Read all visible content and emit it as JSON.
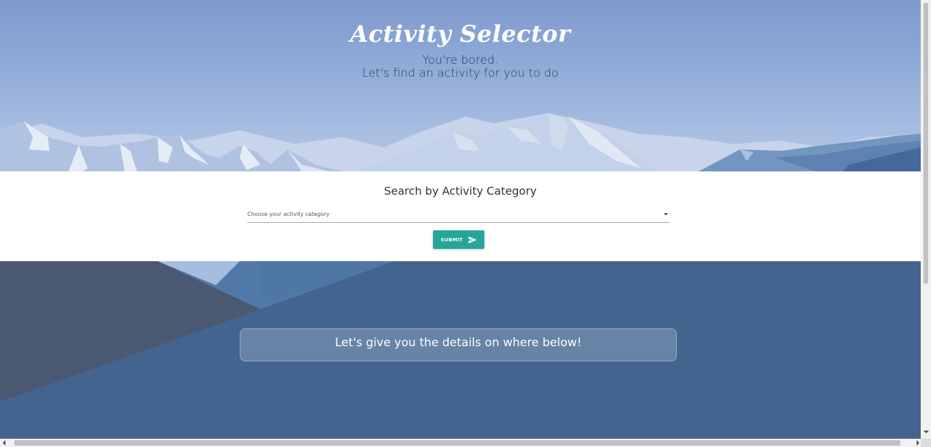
{
  "hero": {
    "title": "Activity Selector",
    "subtitle_line1": "You're bored.",
    "subtitle_line2": "Let's find an activity for you to do"
  },
  "search": {
    "title": "Search by Activity Category",
    "select_placeholder": "Choose your activity category",
    "submit_label": "SUBMIT",
    "submit_icon": "send-icon"
  },
  "info": {
    "text": "Let's give you the details on where below!"
  },
  "colors": {
    "accent": "#26a69a",
    "hero_sky": "#8da9d6",
    "bottom_bg": "#42648f",
    "bottom_dark": "#4a5872"
  }
}
